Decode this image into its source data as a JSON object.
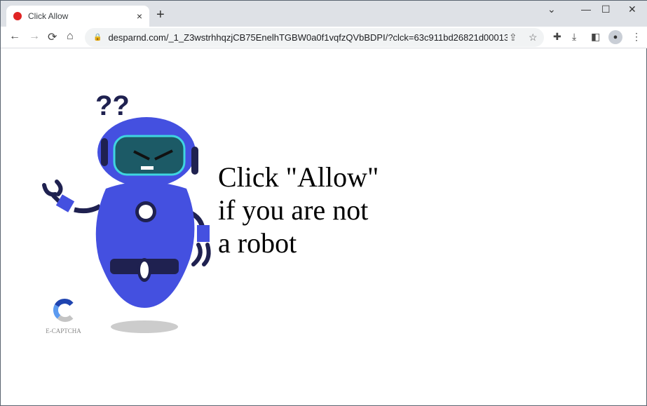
{
  "tab": {
    "title": "Click Allow",
    "close": "×",
    "new_tab": "+"
  },
  "window": {
    "dropdown": "⌄",
    "minimize": "—",
    "maximize": "☐",
    "close": "✕"
  },
  "nav": {
    "back": "←",
    "forward": "→",
    "reload": "⟳",
    "home": "⌂"
  },
  "address": {
    "url": "desparnd.com/_1_Z3wstrhhqzjCB75EnelhTGBW0a0f1vqfzQVbBDPI/?clck=63c911bd26821d0001373674&si..."
  },
  "page": {
    "headline_lines": [
      "Click \"Allow\"",
      "if you are not",
      "a robot"
    ],
    "captcha_label": "E-CAPTCHA",
    "question_marks": "??"
  },
  "colors": {
    "robot_body": "#4450e0",
    "robot_dark": "#1f2150",
    "visor": "#1c5a66"
  }
}
